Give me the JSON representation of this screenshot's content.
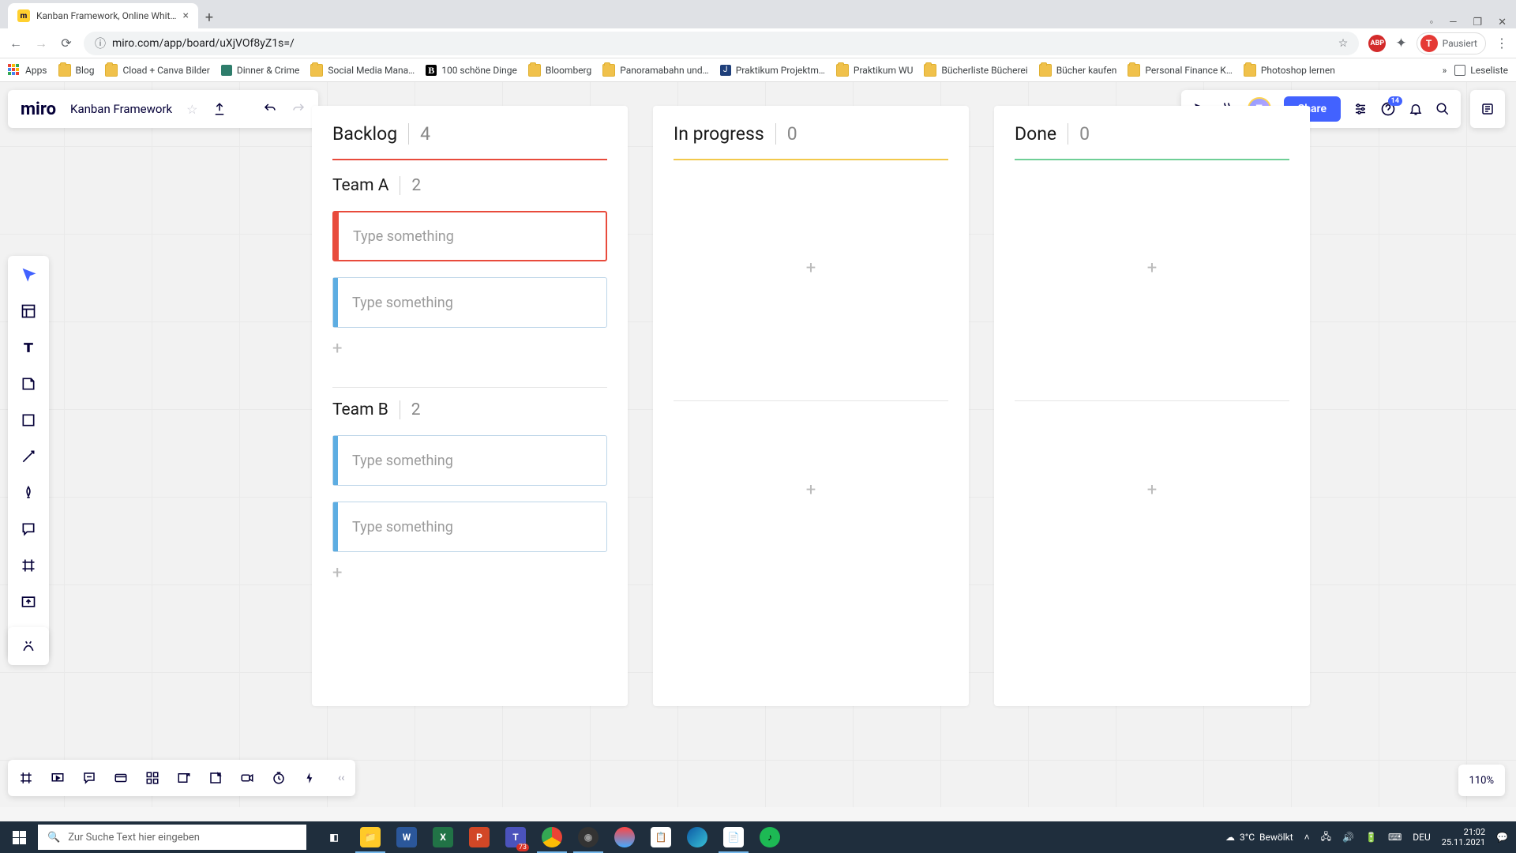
{
  "browser": {
    "tab_title": "Kanban Framework, Online Whit…",
    "url": "miro.com/app/board/uXjVOf8yZ1s=/",
    "profile_label": "Pausiert",
    "profile_initial": "T",
    "bookmarks": [
      {
        "label": "Apps",
        "kind": "apps"
      },
      {
        "label": "Blog",
        "kind": "folder"
      },
      {
        "label": "Cload + Canva Bilder",
        "kind": "folder"
      },
      {
        "label": "Dinner & Crime",
        "kind": "site",
        "color": "#2e7d6b"
      },
      {
        "label": "Social Media Mana…",
        "kind": "folder"
      },
      {
        "label": "100 schöne Dinge",
        "kind": "site",
        "color": "#000"
      },
      {
        "label": "Bloomberg",
        "kind": "folder"
      },
      {
        "label": "Panoramabahn und…",
        "kind": "folder"
      },
      {
        "label": "Praktikum Projektm…",
        "kind": "site",
        "color": "#1f3f7a"
      },
      {
        "label": "Praktikum WU",
        "kind": "folder"
      },
      {
        "label": "Bücherliste Bücherei",
        "kind": "folder"
      },
      {
        "label": "Bücher kaufen",
        "kind": "folder"
      },
      {
        "label": "Personal Finance K…",
        "kind": "folder"
      },
      {
        "label": "Photoshop lernen",
        "kind": "folder"
      }
    ],
    "overflow_label": "»",
    "reading_list": "Leseliste"
  },
  "miro": {
    "logo": "miro",
    "board_name": "Kanban Framework",
    "share_label": "Share",
    "notif_badge": "14",
    "zoom": "110%"
  },
  "kanban": {
    "columns": [
      {
        "title": "Backlog",
        "count": "4",
        "color": "red"
      },
      {
        "title": "In progress",
        "count": "0",
        "color": "yellow"
      },
      {
        "title": "Done",
        "count": "0",
        "color": "green"
      }
    ],
    "swimlanes": [
      {
        "name": "Team A",
        "count": "2",
        "cards": [
          {
            "ph": "Type something",
            "style": "red"
          },
          {
            "ph": "Type something",
            "style": "blue"
          }
        ]
      },
      {
        "name": "Team B",
        "count": "2",
        "cards": [
          {
            "ph": "Type something",
            "style": "blue"
          },
          {
            "ph": "Type something",
            "style": "blue"
          }
        ]
      }
    ]
  },
  "taskbar": {
    "search_placeholder": "Zur Suche Text hier eingeben",
    "weather_temp": "3°C",
    "weather_text": "Bewölkt",
    "lang": "DEU",
    "time": "21:02",
    "date": "25.11.2021",
    "teams_badge": "73"
  }
}
